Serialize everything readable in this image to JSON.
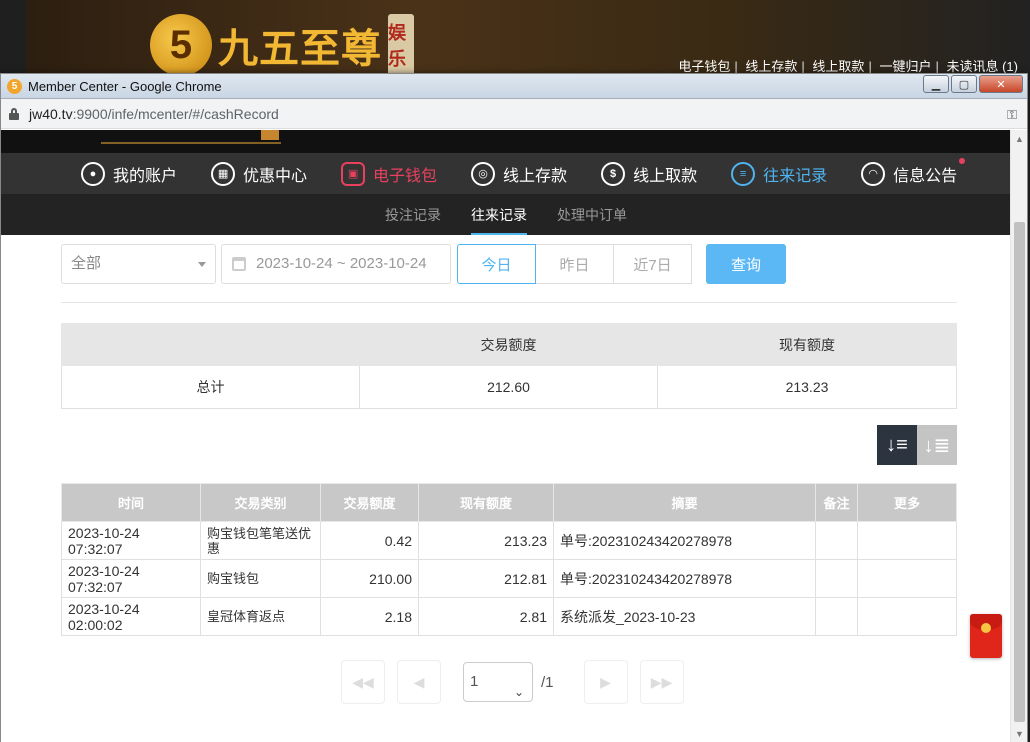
{
  "background": {
    "logo_text": "九五至尊",
    "logo_tag": "娱乐",
    "top_links": [
      "电子钱包",
      "线上存款",
      "线上取款",
      "一键归户",
      "未读讯息 (1)"
    ]
  },
  "window": {
    "title": "Member Center - Google Chrome",
    "url_host": "jw40.tv",
    "url_path": ":9900/infe/mcenter/#/cashRecord"
  },
  "nav": {
    "items": [
      {
        "label": "我的账户",
        "icon": "user-icon"
      },
      {
        "label": "优惠中心",
        "icon": "gift-icon"
      },
      {
        "label": "电子钱包",
        "icon": "wallet-icon"
      },
      {
        "label": "线上存款",
        "icon": "deposit-icon"
      },
      {
        "label": "线上取款",
        "icon": "withdraw-icon"
      },
      {
        "label": "往来记录",
        "icon": "record-icon"
      },
      {
        "label": "信息公告",
        "icon": "bell-icon"
      }
    ]
  },
  "subnav": {
    "items": [
      "投注记录",
      "往来记录",
      "处理中订单"
    ],
    "active": "往来记录"
  },
  "filters": {
    "type_select": "全部",
    "date_range": "2023-10-24 ~ 2023-10-24",
    "quick_ranges": [
      "今日",
      "昨日",
      "近7日"
    ],
    "active_range": "今日",
    "query_label": "查询"
  },
  "summary": {
    "headers": [
      "",
      "交易额度",
      "现有额度"
    ],
    "row": [
      "总计",
      "212.60",
      "213.23"
    ]
  },
  "records": {
    "headers": [
      "时间",
      "交易类别",
      "交易额度",
      "现有额度",
      "摘要",
      "备注",
      "更多"
    ],
    "rows": [
      [
        "2023-10-24 07:32:07",
        "购宝钱包笔笔送优惠",
        "0.42",
        "213.23",
        "单号:202310243420278978",
        "",
        ""
      ],
      [
        "2023-10-24 07:32:07",
        "购宝钱包",
        "210.00",
        "212.81",
        "单号:202310243420278978",
        "",
        ""
      ],
      [
        "2023-10-24 02:00:02",
        "皇冠体育返点",
        "2.18",
        "2.81",
        "系统派发_2023-10-23",
        "",
        ""
      ]
    ]
  },
  "pager": {
    "current": "1",
    "total": "/1"
  },
  "colors": {
    "accent_blue": "#4fb4f0",
    "accent_red": "#e8415f",
    "nav_bg": "#333333"
  }
}
